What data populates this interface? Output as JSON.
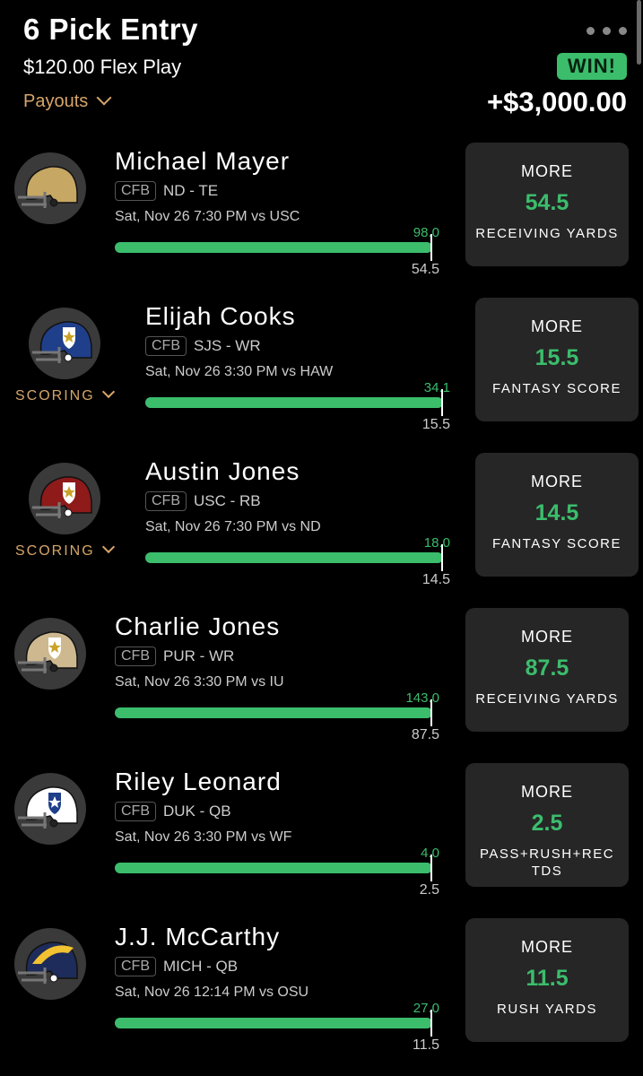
{
  "header": {
    "title": "6 Pick Entry",
    "subtitle": "$120.00 Flex Play",
    "payouts_label": "Payouts",
    "result_badge": "WIN!",
    "result_amount": "+$3,000.00"
  },
  "colors": {
    "accent": "#3bbd6c",
    "gold": "#d6a56a",
    "card": "#262626"
  },
  "picks": [
    {
      "name": "Michael Mayer",
      "league": "CFB",
      "team_pos": "ND - TE",
      "game": "Sat, Nov 26 7:30 PM  vs USC",
      "actual": "98.0",
      "line": "54.5",
      "direction": "MORE",
      "stat": "RECEIVING YARDS",
      "progress": 1.0,
      "scoring_label": "",
      "helmet_color": "#c6a763",
      "logo": "none"
    },
    {
      "name": "Elijah Cooks",
      "league": "CFB",
      "team_pos": "SJS - WR",
      "game": "Sat, Nov 26 3:30 PM  vs HAW",
      "actual": "34.1",
      "line": "15.5",
      "direction": "MORE",
      "stat": "FANTASY SCORE",
      "progress": 1.0,
      "scoring_label": "SCORING",
      "helmet_color": "#1f3f8a",
      "logo": "star"
    },
    {
      "name": "Austin Jones",
      "league": "CFB",
      "team_pos": "USC - RB",
      "game": "Sat, Nov 26 7:30 PM  vs ND",
      "actual": "18.0",
      "line": "14.5",
      "direction": "MORE",
      "stat": "FANTASY SCORE",
      "progress": 1.0,
      "scoring_label": "SCORING",
      "helmet_color": "#8e1a1a",
      "logo": "star"
    },
    {
      "name": "Charlie Jones",
      "league": "CFB",
      "team_pos": "PUR - WR",
      "game": "Sat, Nov 26 3:30 PM  vs IU",
      "actual": "143.0",
      "line": "87.5",
      "direction": "MORE",
      "stat": "RECEIVING YARDS",
      "progress": 1.0,
      "scoring_label": "",
      "helmet_color": "#cdb88f",
      "logo": "star"
    },
    {
      "name": "Riley Leonard",
      "league": "CFB",
      "team_pos": "DUK - QB",
      "game": "Sat, Nov 26 3:30 PM  vs WF",
      "actual": "4.0",
      "line": "2.5",
      "direction": "MORE",
      "stat": "PASS+RUSH+REC TDS",
      "progress": 1.0,
      "scoring_label": "",
      "helmet_color": "#ffffff",
      "logo": "star"
    },
    {
      "name": "J.J. McCarthy",
      "league": "CFB",
      "team_pos": "MICH - QB",
      "game": "Sat, Nov 26 12:14 PM  vs OSU",
      "actual": "27.0",
      "line": "11.5",
      "direction": "MORE",
      "stat": "RUSH YARDS",
      "progress": 1.0,
      "scoring_label": "",
      "helmet_color": "#1d2c5a",
      "logo": "wing"
    }
  ]
}
